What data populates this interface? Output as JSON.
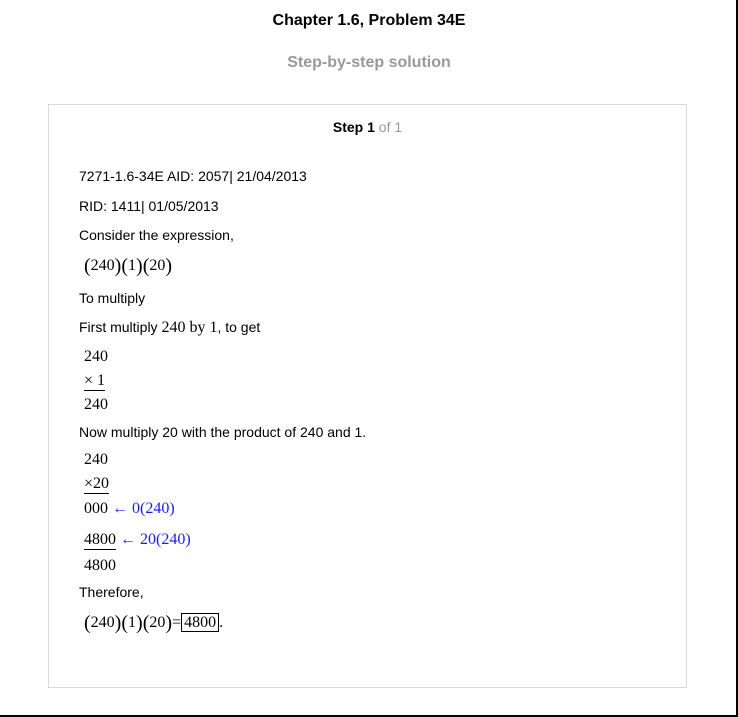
{
  "header": {
    "title": "Chapter 1.6, Problem 34E",
    "subtitle": "Step-by-step solution"
  },
  "step": {
    "word": "Step",
    "number": "1",
    "of": " of 1"
  },
  "content": {
    "aid_line": "7271-1.6-34E AID: 2057| 21/04/2013",
    "rid_line": "RID: 1411| 01/05/2013",
    "consider": "Consider the expression,",
    "to_multiply": "To multiply",
    "first_multiply_prefix": "First multiply ",
    "first_multiply_math": "240 by 1",
    "first_multiply_suffix": ", to get",
    "mult1": {
      "top": "240",
      "second": "× 1",
      "result": "240"
    },
    "now_multiply": "Now multiply 20 with the product of 240 and 1.",
    "mult2": {
      "top": "240",
      "second": "×20",
      "partial1": "000",
      "partial1_note": "← 0(240)",
      "partial2": "4800",
      "partial2_note": "← 20(240)",
      "result": "4800"
    },
    "therefore": "Therefore,",
    "final_answer": "4800"
  },
  "colors": {
    "annotation": "#1a1aff",
    "subtitle": "#999999",
    "card_border": "#d9d9d9"
  }
}
